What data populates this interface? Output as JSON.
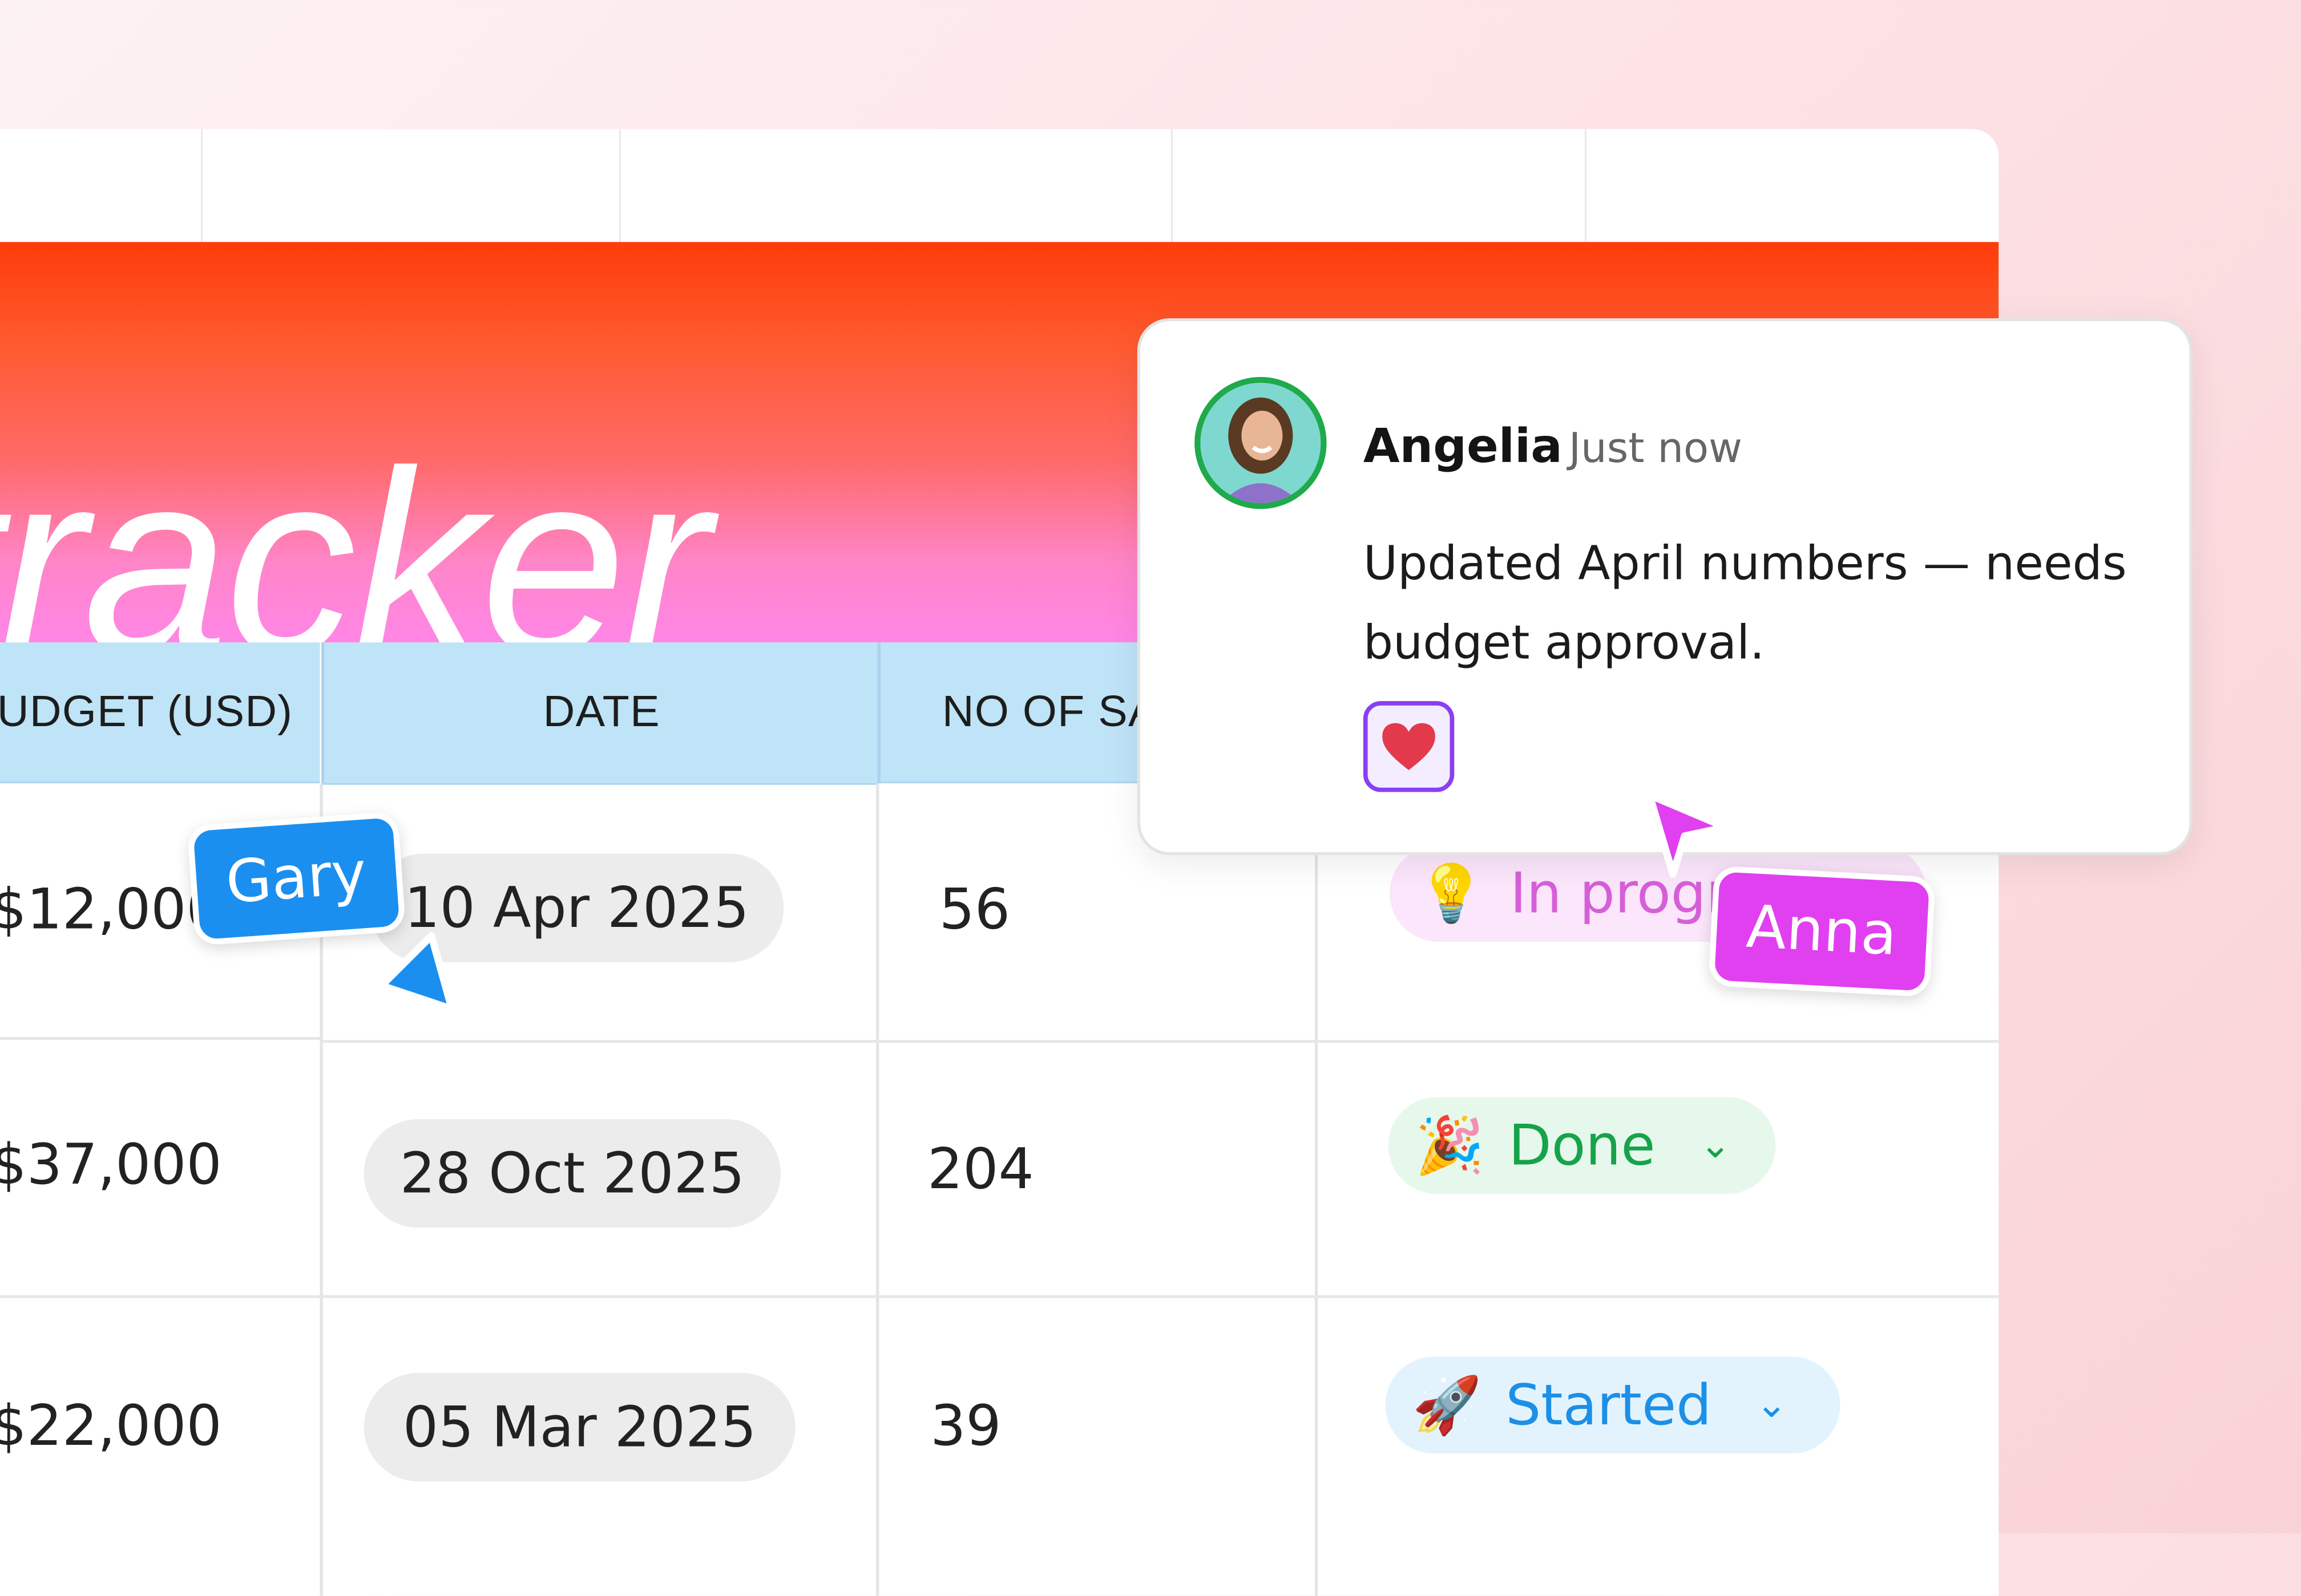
{
  "banner": {
    "title": "tracker"
  },
  "columns": [
    {
      "label": "UDGET (USD)"
    },
    {
      "label": "DATE"
    },
    {
      "label": "NO OF SA"
    }
  ],
  "rows": [
    {
      "budget": "$12,000",
      "date": "10 Apr 2025",
      "count": "56",
      "status": "In progr",
      "status_icon": "lightbulb-icon"
    },
    {
      "budget": "$37,000",
      "date": "28 Oct 2025",
      "count": "204",
      "status": "Done",
      "status_icon": "party-popper-icon"
    },
    {
      "budget": "$22,000",
      "date": "05 Mar 2025",
      "count": "39",
      "status": "Started",
      "status_icon": "rocket-icon"
    }
  ],
  "comment": {
    "author": "Angelia",
    "time": "Just now",
    "text": "Updated April numbers — needs budget approval.",
    "reaction": "heart-icon"
  },
  "cursors": [
    {
      "name": "Gary",
      "color": "#1b8ff0"
    },
    {
      "name": "Anna",
      "color": "#e040f0"
    }
  ],
  "colors": {
    "status_in_progress": "#d65fd8",
    "status_done": "#16a34a",
    "status_started": "#1c8fe6",
    "header_bg": "#bfe3f7"
  }
}
